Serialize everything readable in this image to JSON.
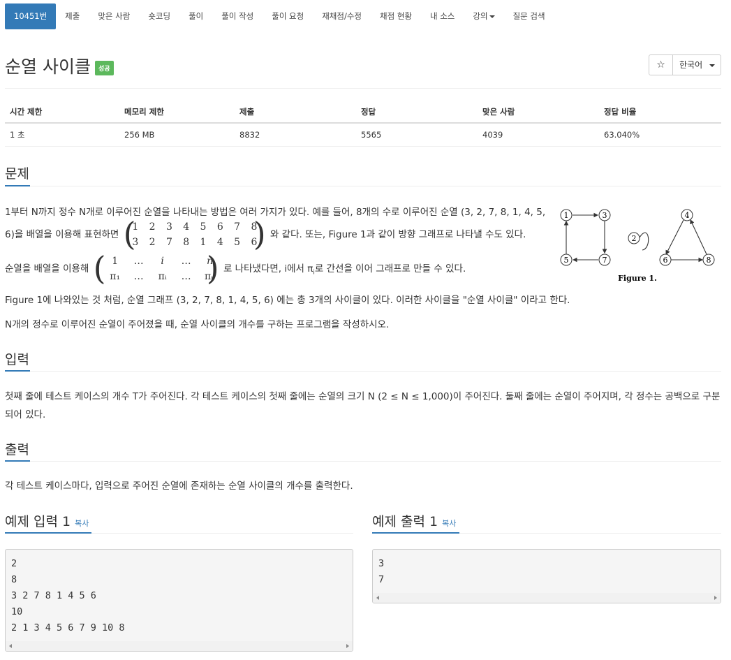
{
  "nav": {
    "items": [
      "10451번",
      "제출",
      "맞은 사람",
      "숏코딩",
      "풀이",
      "풀이 작성",
      "풀이 요청",
      "재채점/수정",
      "채점 현황",
      "내 소스",
      "강의",
      "질문 검색"
    ]
  },
  "header": {
    "title": "순열 사이클",
    "badge": "성공",
    "star": "☆",
    "language": "한국어"
  },
  "info_table": {
    "headers": [
      "시간 제한",
      "메모리 제한",
      "제출",
      "정답",
      "맞은 사람",
      "정답 비율"
    ],
    "values": [
      "1 초",
      "256 MB",
      "8832",
      "5565",
      "4039",
      "63.040%"
    ]
  },
  "problem": {
    "heading": "문제",
    "line1": "1부터 N까지 정수 N개로 이루어진 순열을 나타내는 방법은 여러 가지가 있다. 예를 들어, 8개의 수로 이루어진 순열 (3, 2, 7, 8, 1, 4, 5,",
    "line2_pre": "6)을 배열을 이용해 표현하면",
    "line2_post": "와 같다. 또는, Figure 1과 같이 방향 그래프로 나타낼 수도 있다.",
    "matrix_top": [
      "1",
      "2",
      "3",
      "4",
      "5",
      "6",
      "7",
      "8"
    ],
    "matrix_bottom": [
      "3",
      "2",
      "7",
      "8",
      "1",
      "4",
      "5",
      "6"
    ],
    "line3_pre": "순열을 배열을 이용해",
    "line3_post": "로 나타냈다면, i에서 π",
    "line3_sub": "i",
    "line3_end": "로 간선을 이어 그래프로 만들 수 있다.",
    "gen_top": [
      "1",
      "…",
      "i",
      "…",
      "n"
    ],
    "gen_bottom": [
      "π₁",
      "…",
      "πᵢ",
      "…",
      "πₙ"
    ],
    "line4": "Figure 1에 나와있는 것 처럼, 순열 그래프 (3, 2, 7, 8, 1, 4, 5, 6) 에는 총 3개의 사이클이 있다. 이러한 사이클을 \"순열 사이클\" 이라고 한다.",
    "line5": "N개의 정수로 이루어진 순열이 주어졌을 때, 순열 사이클의 개수를 구하는 프로그램을 작성하시오.",
    "figure_caption": "Figure 1.",
    "figure_nodes": [
      "1",
      "3",
      "5",
      "7",
      "2",
      "4",
      "6",
      "8"
    ]
  },
  "input": {
    "heading": "입력",
    "text": "첫째 줄에 테스트 케이스의 개수 T가 주어진다. 각 테스트 케이스의 첫째 줄에는 순열의 크기 N (2 ≤ N ≤ 1,000)이 주어진다. 둘째 줄에는 순열이 주어지며, 각 정수는 공백으로 구분되어 있다."
  },
  "output": {
    "heading": "출력",
    "text": "각 테스트 케이스마다, 입력으로 주어진 순열에 존재하는 순열 사이클의 개수를 출력한다."
  },
  "sample_input": {
    "heading": "예제 입력 1",
    "copy": "복사",
    "lines": [
      "2",
      "8",
      "3 2 7 8 1 4 5 6",
      "10",
      "2 1 3 4 5 6 7 9 10 8"
    ]
  },
  "sample_output": {
    "heading": "예제 출력 1",
    "copy": "복사",
    "lines": [
      "3",
      "7"
    ]
  }
}
